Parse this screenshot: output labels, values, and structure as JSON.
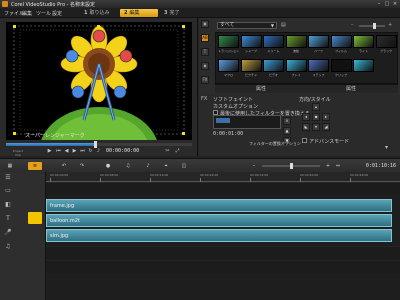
{
  "window": {
    "title": "Corel VideoStudio Pro - 名称未設定"
  },
  "menu": [
    "ファイル",
    "編集",
    "ツール",
    "設定"
  ],
  "steps": [
    {
      "num": "1",
      "label": "取り込み",
      "active": false
    },
    {
      "num": "2",
      "label": "編集",
      "active": true
    },
    {
      "num": "3",
      "label": "完了",
      "active": false
    }
  ],
  "preview": {
    "overlay_text": "スーパーレンジャーマーク",
    "timecode": "00:00:00:00",
    "progress": 0.48,
    "mode_labels": [
      "Project",
      "Clip"
    ]
  },
  "library": {
    "category": "すべて",
    "tool_icons": [
      "media-icon",
      "transition-icon",
      "title-icon",
      "graphic-icon",
      "filter-icon"
    ],
    "thumbnails": [
      {
        "caption": "トランジション",
        "color": "#2f8c4b"
      },
      {
        "caption": "シャープ",
        "color": "#3b8ed6"
      },
      {
        "caption": "ドリーム",
        "color": "#2e6cb8"
      },
      {
        "caption": "波紋",
        "color": "#6a9e2c"
      },
      {
        "caption": "ハーフ",
        "color": "#4fa0d8"
      },
      {
        "caption": "フィルム",
        "color": "#4a88c9"
      },
      {
        "caption": "ライト",
        "color": "#7dbf3a"
      },
      {
        "caption": "ブラック",
        "color": "#2d2d2d"
      },
      {
        "caption": "マクロ",
        "color": "#5c9de0"
      },
      {
        "caption": "ピクチャ",
        "color": "#b8a040"
      },
      {
        "caption": "ビデオ",
        "color": "#3c9bd5"
      },
      {
        "caption": "プレイ",
        "color": "#3bb0d8"
      },
      {
        "caption": "ステップ",
        "color": "#4c6db8"
      },
      {
        "caption": "クリップ",
        "color": "#111111"
      },
      {
        "caption": "",
        "color": "#37b9d6"
      }
    ],
    "tabs": [
      "属性",
      "属性"
    ]
  },
  "options": {
    "effect_label": "ソフトフェイント",
    "custom_label": "カスタムオプション",
    "apply_label": "最後に使用したフィルターを置き換える",
    "duration": "0:00:01:00",
    "style_label": "方向/スタイル",
    "filter_button": "フィルターの置換オプション",
    "preview_label": "アドバンスモード"
  },
  "timeline": {
    "timecode": "0:01:10:16",
    "ruler": [
      "00:00:00:00",
      "00:00:08:00",
      "00:00:16:00",
      "00:00:24:00",
      "00:00:32:00",
      "00:00:40:00",
      "00:00:48:00"
    ],
    "clips": [
      {
        "label": "frame.jpg"
      },
      {
        "label": "balloon.m2t"
      },
      {
        "label": "sim.jpg"
      }
    ]
  }
}
